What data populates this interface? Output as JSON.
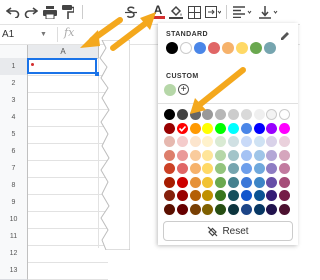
{
  "toolbar": {
    "icons": [
      "undo-icon",
      "redo-icon",
      "print-icon",
      "paint-format-icon",
      "strikethrough-icon",
      "text-color-icon",
      "fill-color-icon",
      "borders-icon",
      "merge-cells-icon",
      "horizontal-align-icon",
      "vertical-align-icon"
    ],
    "text_color_glyph": "A",
    "text_color_underline": "#d32f2f"
  },
  "formula_bar": {
    "name_box": "A1",
    "fx": "fx"
  },
  "sheet": {
    "column": "A",
    "rows": [
      "1",
      "2",
      "3",
      "4",
      "5",
      "6",
      "7",
      "8",
      "9",
      "10",
      "11",
      "12",
      "13"
    ],
    "selected_cell": "A1"
  },
  "panel": {
    "standard_label": "STANDARD",
    "standard_colors": [
      "#000000",
      "#ffffff",
      "#4a86e8",
      "#e06666",
      "#f6b26b",
      "#ffd966",
      "#6aa84f",
      "#76a5af"
    ],
    "custom_label": "CUSTOM",
    "custom_colors": [
      "#b6d7a8"
    ],
    "palette": [
      [
        "#000000",
        "#434343",
        "#666666",
        "#999999",
        "#b7b7b7",
        "#cccccc",
        "#d9d9d9",
        "#efefef",
        "#f3f3f3",
        "#ffffff"
      ],
      [
        "#980000",
        "#ff0000",
        "#ff9900",
        "#ffff00",
        "#00ff00",
        "#00ffff",
        "#4a86e8",
        "#0000ff",
        "#9900ff",
        "#ff00ff"
      ],
      [
        "#e6b8af",
        "#f4cccc",
        "#fce5cd",
        "#fff2cc",
        "#d9ead3",
        "#d0e0e3",
        "#c9daf8",
        "#cfe2f3",
        "#d9d2e9",
        "#ead1dc"
      ],
      [
        "#dd7e6b",
        "#ea9999",
        "#f9cb9c",
        "#ffe599",
        "#b6d7a8",
        "#a2c4c9",
        "#a4c2f4",
        "#9fc5e8",
        "#b4a7d6",
        "#d5a6bd"
      ],
      [
        "#cc4125",
        "#e06666",
        "#f6b26b",
        "#ffd966",
        "#93c47d",
        "#76a5af",
        "#6d9eeb",
        "#6fa8dc",
        "#8e7cc3",
        "#c27ba0"
      ],
      [
        "#a61c00",
        "#cc0000",
        "#e69138",
        "#f1c232",
        "#6aa84f",
        "#45818e",
        "#3c78d8",
        "#3d85c6",
        "#674ea7",
        "#a64d79"
      ],
      [
        "#85200c",
        "#990000",
        "#b45f06",
        "#bf9000",
        "#38761d",
        "#134f5c",
        "#1155cc",
        "#0b5394",
        "#351c75",
        "#741b47"
      ],
      [
        "#5b0f00",
        "#660000",
        "#783f04",
        "#7f6000",
        "#274e13",
        "#0c343d",
        "#1c4587",
        "#073763",
        "#20124d",
        "#4c1130"
      ]
    ],
    "selected": "#ff0000",
    "reset_label": "Reset"
  },
  "colors": {
    "arrow": "#f4a81d",
    "selection": "#1a73e8"
  }
}
